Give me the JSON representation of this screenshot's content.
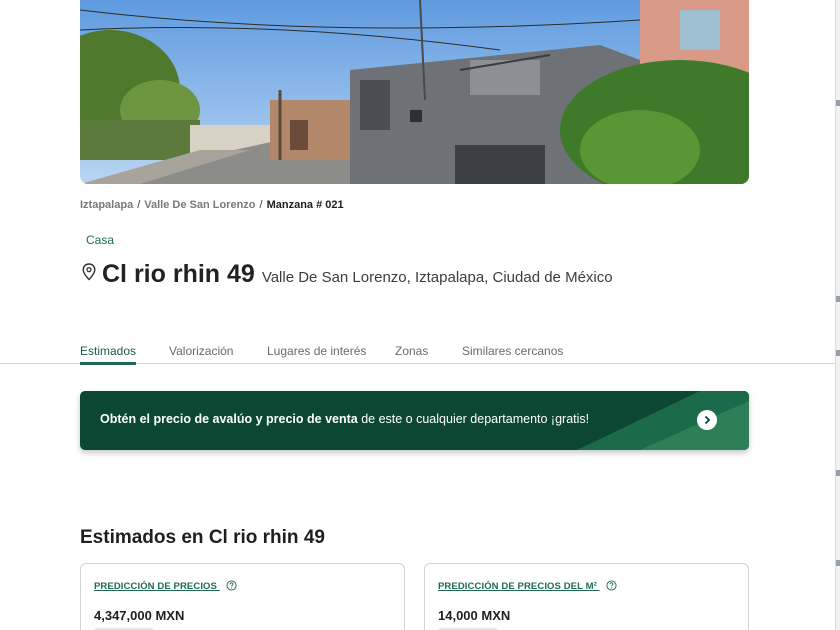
{
  "breadcrumb": {
    "items": [
      {
        "label": "Iztapalapa"
      },
      {
        "label": "Valle De San Lorenzo"
      }
    ],
    "current": "Manzana # 021",
    "separator": "/"
  },
  "property": {
    "type": "Casa",
    "title": "Cl rio rhin 49",
    "location": "Valle De San Lorenzo, Iztapalapa, Ciudad de México"
  },
  "tabs": [
    {
      "label": "Estimados",
      "active": true
    },
    {
      "label": "Valorización",
      "active": false
    },
    {
      "label": "Lugares de interés",
      "active": false
    },
    {
      "label": "Zonas",
      "active": false
    },
    {
      "label": "Similares cercanos",
      "active": false
    }
  ],
  "banner": {
    "bold_text": "Obtén el precio de avalúo y precio de venta",
    "rest_text": " de este o cualquier departamento ¡gratis!"
  },
  "estimates": {
    "title": "Estimados en Cl rio rhin 49",
    "cards": [
      {
        "label": "PREDICCIÓN DE PRECIOS",
        "value": "4,347,000 MXN"
      },
      {
        "label": "PREDICCIÓN DE PRECIOS DEL M²",
        "value": "14,000 MXN"
      }
    ]
  },
  "colors": {
    "accent": "#1f6b52",
    "banner_bg": "#0c4733"
  },
  "icons": {
    "photo_control": "view-360-icon",
    "location": "location-pin-icon",
    "banner_action": "chevron-right-icon",
    "help": "help-circle-icon"
  }
}
